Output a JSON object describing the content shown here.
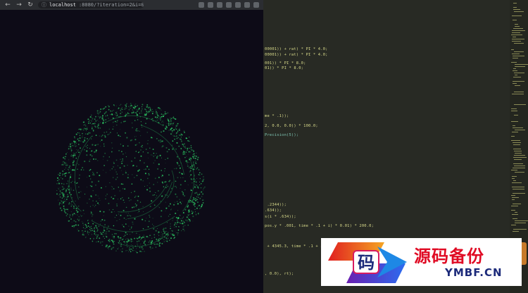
{
  "browser": {
    "url_host": "localhost",
    "url_path": ":8080/?iteration=2&i=0"
  },
  "editor": {
    "lines": [
      {
        "text": "00001)) + rat) * PI * 4.0;",
        "style": "yellow"
      },
      {
        "text": "00001)) + rat) * PI * 4.0;",
        "style": "yellow"
      },
      {
        "text": "001)) * PI * 8.0;",
        "style": "yellow"
      },
      {
        "text": "01)) * PI * 8.0;",
        "style": "yellow"
      },
      {
        "text": "me * .1));",
        "style": "yellow"
      },
      {
        "text": "2, 0.0, 0.0)) * 100.0;",
        "style": "yellow"
      },
      {
        "text": "Precision(5));",
        "style": "teal"
      },
      {
        "text": " .2344));",
        "style": "yellow"
      },
      {
        "text": ".634));",
        "style": "yellow"
      },
      {
        "text": "s(i * .634));",
        "style": "yellow"
      },
      {
        "text": "pos.y * .001, time * .1 + i) * 0.01) * 200.0;",
        "style": "yellow"
      },
      {
        "text": " + 4345.3, time * .1 + i",
        "style": "yellow"
      },
      {
        "text": ", 0.0), rt);",
        "style": "yellow"
      }
    ]
  },
  "watermark": {
    "logo_char": "码",
    "title": "源码备份",
    "site": "YMBF.CN"
  },
  "colors": {
    "particle": "#2fd86a",
    "background": "#0d0b17",
    "editor_bg": "#282a24",
    "code_yellow": "#d7d98a",
    "code_teal": "#7fc6b4",
    "watermark_red": "#e00b24",
    "watermark_blue": "#1c2a7a"
  }
}
